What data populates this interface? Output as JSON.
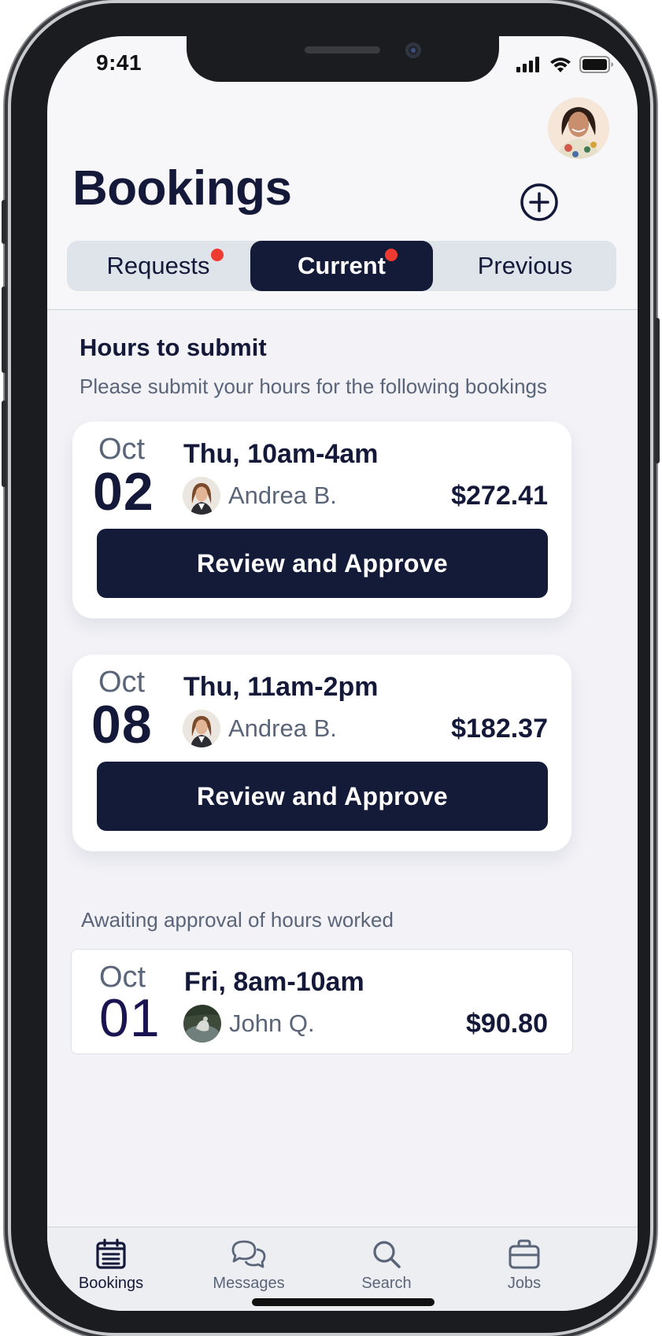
{
  "status_bar": {
    "time": "9:41"
  },
  "header": {
    "title": "Bookings"
  },
  "tabs": [
    {
      "label": "Requests",
      "has_notification": true
    },
    {
      "label": "Current",
      "has_notification": true,
      "active": true
    },
    {
      "label": "Previous",
      "has_notification": false
    }
  ],
  "hours_section": {
    "heading": "Hours to submit",
    "subtitle": "Please submit your hours for the following bookings"
  },
  "bookings_to_submit": [
    {
      "month": "Oct",
      "day": "02",
      "time": "Thu, 10am-4am",
      "person": "Andrea B.",
      "amount": "$272.41",
      "button": "Review and Approve"
    },
    {
      "month": "Oct",
      "day": "08",
      "time": "Thu, 11am-2pm",
      "person": "Andrea B.",
      "amount": "$182.37",
      "button": "Review and Approve"
    }
  ],
  "awaiting_section": {
    "label": "Awaiting approval of hours worked"
  },
  "awaiting_bookings": [
    {
      "month": "Oct",
      "day": "01",
      "time": "Fri, 8am-10am",
      "person": "John Q.",
      "amount": "$90.80"
    }
  ],
  "tab_bar": [
    {
      "label": "Bookings",
      "icon": "calendar-list-icon",
      "active": true
    },
    {
      "label": "Messages",
      "icon": "chat-bubbles-icon"
    },
    {
      "label": "Search",
      "icon": "search-icon"
    },
    {
      "label": "Jobs",
      "icon": "briefcase-icon"
    }
  ],
  "colors": {
    "navy": "#141b38",
    "notification": "#ee3a30",
    "muted": "#5b6579"
  }
}
